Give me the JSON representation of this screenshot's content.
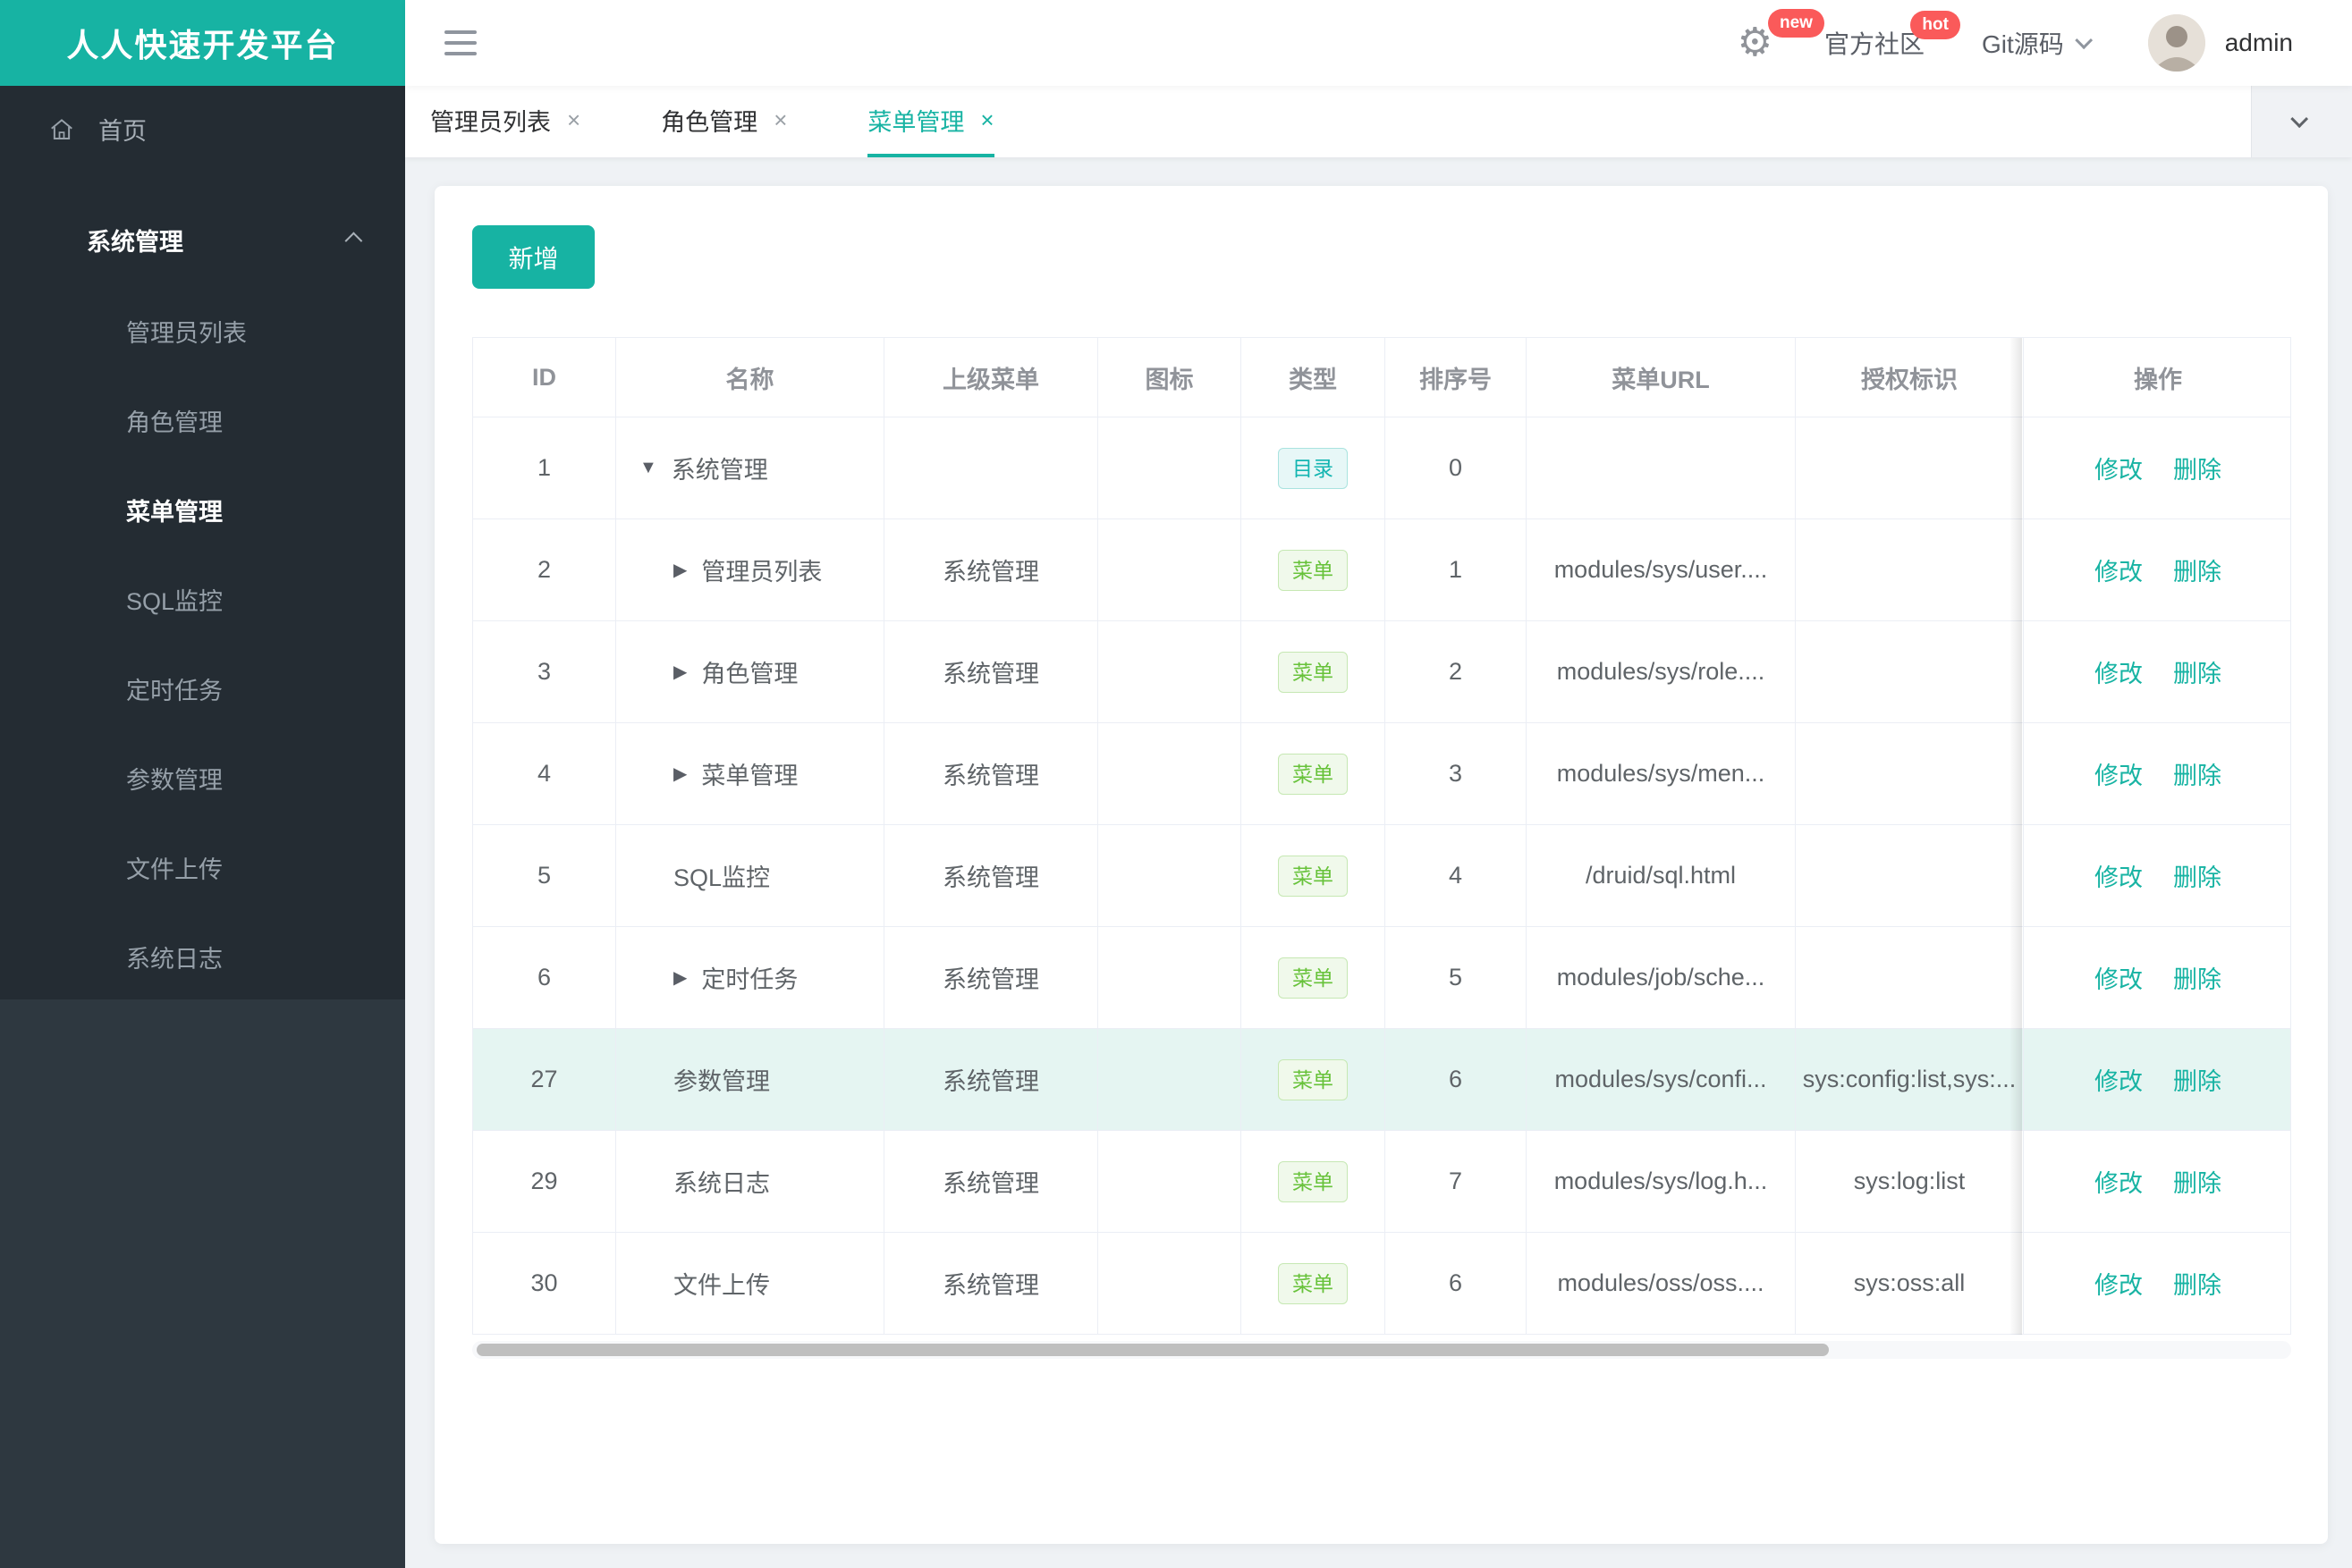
{
  "app": {
    "title": "人人快速开发平台"
  },
  "topbar": {
    "badge_new": "new",
    "badge_hot": "hot",
    "community": "官方社区",
    "git_label": "Git源码",
    "user": "admin"
  },
  "sidebar": {
    "home_label": "首页",
    "group_label": "系统管理",
    "items": [
      {
        "label": "管理员列表",
        "active": false
      },
      {
        "label": "角色管理",
        "active": false
      },
      {
        "label": "菜单管理",
        "active": true
      },
      {
        "label": "SQL监控",
        "active": false
      },
      {
        "label": "定时任务",
        "active": false
      },
      {
        "label": "参数管理",
        "active": false
      },
      {
        "label": "文件上传",
        "active": false
      },
      {
        "label": "系统日志",
        "active": false
      }
    ]
  },
  "tabs": [
    {
      "label": "管理员列表",
      "close": "×",
      "active": false
    },
    {
      "label": "角色管理",
      "close": "×",
      "active": false
    },
    {
      "label": "菜单管理",
      "close": "×",
      "active": true
    }
  ],
  "toolbar": {
    "add_label": "新增"
  },
  "table": {
    "columns": [
      "ID",
      "名称",
      "上级菜单",
      "图标",
      "类型",
      "排序号",
      "菜单URL",
      "授权标识",
      "操作"
    ],
    "actions": {
      "edit": "修改",
      "delete": "删除"
    },
    "rows": [
      {
        "id": "1",
        "arrow": "down",
        "root": true,
        "name": "系统管理",
        "parent": "",
        "icon": "",
        "type": "目录",
        "order": "0",
        "url": "",
        "auth": "",
        "highlight": false
      },
      {
        "id": "2",
        "arrow": "right",
        "root": false,
        "name": "管理员列表",
        "parent": "系统管理",
        "icon": "",
        "type": "菜单",
        "order": "1",
        "url": "modules/sys/user....",
        "auth": "",
        "highlight": false
      },
      {
        "id": "3",
        "arrow": "right",
        "root": false,
        "name": "角色管理",
        "parent": "系统管理",
        "icon": "",
        "type": "菜单",
        "order": "2",
        "url": "modules/sys/role....",
        "auth": "",
        "highlight": false
      },
      {
        "id": "4",
        "arrow": "right",
        "root": false,
        "name": "菜单管理",
        "parent": "系统管理",
        "icon": "",
        "type": "菜单",
        "order": "3",
        "url": "modules/sys/men...",
        "auth": "",
        "highlight": false
      },
      {
        "id": "5",
        "arrow": "",
        "root": false,
        "name": "SQL监控",
        "parent": "系统管理",
        "icon": "",
        "type": "菜单",
        "order": "4",
        "url": "/druid/sql.html",
        "auth": "",
        "highlight": false
      },
      {
        "id": "6",
        "arrow": "right",
        "root": false,
        "name": "定时任务",
        "parent": "系统管理",
        "icon": "",
        "type": "菜单",
        "order": "5",
        "url": "modules/job/sche...",
        "auth": "",
        "highlight": false
      },
      {
        "id": "27",
        "arrow": "",
        "root": false,
        "name": "参数管理",
        "parent": "系统管理",
        "icon": "",
        "type": "菜单",
        "order": "6",
        "url": "modules/sys/confi...",
        "auth": "sys:config:list,sys:...",
        "highlight": true
      },
      {
        "id": "29",
        "arrow": "",
        "root": false,
        "name": "系统日志",
        "parent": "系统管理",
        "icon": "",
        "type": "菜单",
        "order": "7",
        "url": "modules/sys/log.h...",
        "auth": "sys:log:list",
        "highlight": false
      },
      {
        "id": "30",
        "arrow": "",
        "root": false,
        "name": "文件上传",
        "parent": "系统管理",
        "icon": "",
        "type": "菜单",
        "order": "6",
        "url": "modules/oss/oss....",
        "auth": "sys:oss:all",
        "highlight": false
      }
    ]
  },
  "colors": {
    "accent_teal": "#17B3A3",
    "badge_red": "#FA5A5A",
    "sidebar_dark": "#2E3840",
    "sidebar_menu_dark": "#242C33",
    "tag_dir_text": "#13B5B1",
    "tag_menu_text": "#67C23A",
    "row_highlight": "#E5F5F2",
    "table_border": "#EBEEF5"
  }
}
